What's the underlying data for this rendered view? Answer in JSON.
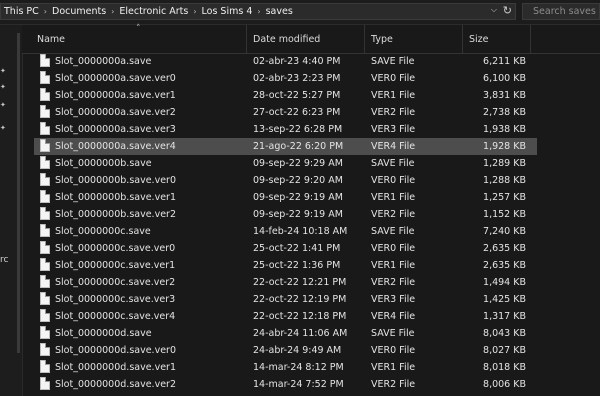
{
  "address": {
    "crumbs": [
      "This PC",
      "Documents",
      "Electronic Arts",
      "Los Sims 4",
      "saves"
    ],
    "dropdown_icon": "chevron-down-icon",
    "refresh_icon": "refresh-icon"
  },
  "search": {
    "placeholder": "Search saves"
  },
  "nav": {
    "partial_text": "rc"
  },
  "columns": {
    "name": "Name",
    "date": "Date modified",
    "type": "Type",
    "size": "Size"
  },
  "selected_index": 5,
  "files": [
    {
      "name": "Slot_0000000a.save",
      "date": "02-abr-23 4:40 PM",
      "type": "SAVE File",
      "size": "6,211 KB"
    },
    {
      "name": "Slot_0000000a.save.ver0",
      "date": "02-abr-23 2:23 PM",
      "type": "VER0 File",
      "size": "6,100 KB"
    },
    {
      "name": "Slot_0000000a.save.ver1",
      "date": "28-oct-22 5:27 PM",
      "type": "VER1 File",
      "size": "3,831 KB"
    },
    {
      "name": "Slot_0000000a.save.ver2",
      "date": "27-oct-22 6:23 PM",
      "type": "VER2 File",
      "size": "2,738 KB"
    },
    {
      "name": "Slot_0000000a.save.ver3",
      "date": "13-sep-22 6:28 PM",
      "type": "VER3 File",
      "size": "1,938 KB"
    },
    {
      "name": "Slot_0000000a.save.ver4",
      "date": "21-ago-22 6:20 PM",
      "type": "VER4 File",
      "size": "1,928 KB"
    },
    {
      "name": "Slot_0000000b.save",
      "date": "09-sep-22 9:29 AM",
      "type": "SAVE File",
      "size": "1,289 KB"
    },
    {
      "name": "Slot_0000000b.save.ver0",
      "date": "09-sep-22 9:20 AM",
      "type": "VER0 File",
      "size": "1,288 KB"
    },
    {
      "name": "Slot_0000000b.save.ver1",
      "date": "09-sep-22 9:19 AM",
      "type": "VER1 File",
      "size": "1,257 KB"
    },
    {
      "name": "Slot_0000000b.save.ver2",
      "date": "09-sep-22 9:19 AM",
      "type": "VER2 File",
      "size": "1,152 KB"
    },
    {
      "name": "Slot_0000000c.save",
      "date": "14-feb-24 10:18 AM",
      "type": "SAVE File",
      "size": "7,240 KB"
    },
    {
      "name": "Slot_0000000c.save.ver0",
      "date": "25-oct-22 1:41 PM",
      "type": "VER0 File",
      "size": "2,635 KB"
    },
    {
      "name": "Slot_0000000c.save.ver1",
      "date": "25-oct-22 1:36 PM",
      "type": "VER1 File",
      "size": "2,635 KB"
    },
    {
      "name": "Slot_0000000c.save.ver2",
      "date": "22-oct-22 12:21 PM",
      "type": "VER2 File",
      "size": "1,494 KB"
    },
    {
      "name": "Slot_0000000c.save.ver3",
      "date": "22-oct-22 12:19 PM",
      "type": "VER3 File",
      "size": "1,425 KB"
    },
    {
      "name": "Slot_0000000c.save.ver4",
      "date": "22-oct-22 12:18 PM",
      "type": "VER4 File",
      "size": "1,317 KB"
    },
    {
      "name": "Slot_0000000d.save",
      "date": "24-abr-24 11:06 AM",
      "type": "SAVE File",
      "size": "8,043 KB"
    },
    {
      "name": "Slot_0000000d.save.ver0",
      "date": "24-abr-24 9:49 AM",
      "type": "VER0 File",
      "size": "8,027 KB"
    },
    {
      "name": "Slot_0000000d.save.ver1",
      "date": "14-mar-24 8:12 PM",
      "type": "VER1 File",
      "size": "8,018 KB"
    },
    {
      "name": "Slot_0000000d.save.ver2",
      "date": "14-mar-24 7:52 PM",
      "type": "VER2 File",
      "size": "8,006 KB"
    }
  ]
}
